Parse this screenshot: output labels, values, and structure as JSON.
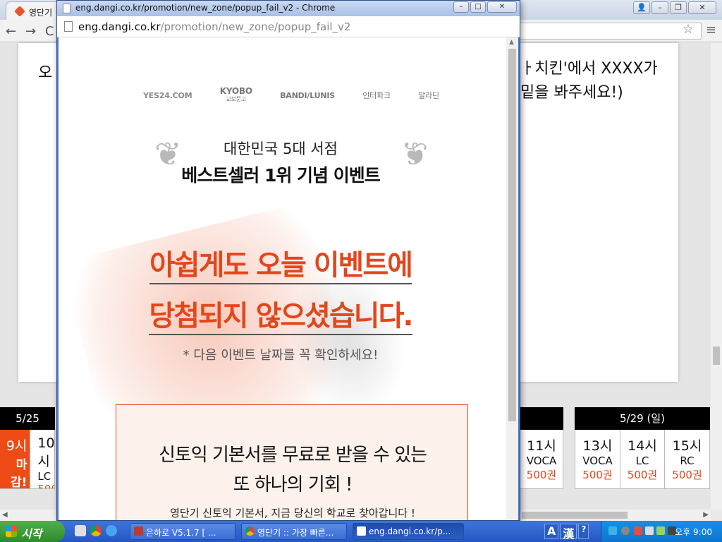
{
  "bg_window": {
    "tab_label": "영단기",
    "card_text_left": "오",
    "card_text_right_1": "ㅏ치킨'에서 XXXX가",
    "card_text_right_2": "밑을 봐주세요!)",
    "schedule_left": {
      "date": "5/25",
      "cells": [
        {
          "time": "9시",
          "label": "마감!",
          "closed": true
        },
        {
          "time": "10시",
          "subject": "LC",
          "price": "500권"
        }
      ]
    },
    "schedule_mid": {
      "cells": [
        {
          "time": "11시",
          "subject": "VOCA",
          "price": "500권"
        }
      ]
    },
    "schedule_right": {
      "date": "5/29 (일)",
      "cells": [
        {
          "time": "13시",
          "subject": "VOCA",
          "price": "500권"
        },
        {
          "time": "14시",
          "subject": "LC",
          "price": "500권"
        },
        {
          "time": "15시",
          "subject": "RC",
          "price": "500권"
        }
      ]
    }
  },
  "popup": {
    "title": "eng.dangi.co.kr/promotion/new_zone/popup_fail_v2 - Chrome",
    "url_domain": "eng.dangi.co.kr",
    "url_path": "/promotion/new_zone/popup_fail_v2",
    "logos": [
      "YES24.COM",
      "KYOBO",
      "교보문고",
      "BANDI/LUNIS",
      "인터파크",
      "알라딘"
    ],
    "subtitle": "대한민국 5대 서점",
    "main_title": "베스트셀러 1위 기념 이벤트",
    "fail_line_1": "아쉽게도 오늘 이벤트에",
    "fail_line_2": "당첨되지 않으셨습니다.",
    "note": "* 다음 이벤트 날짜를 꼭 확인하세요!",
    "promo_line_1": "신토익 기본서를 무료로 받을 수 있는",
    "promo_line_2": "또 하나의 기회 !",
    "promo_desc": "영단기 신토익 기본서, 지금 당신의 학교로 찾아갑니다 !"
  },
  "taskbar": {
    "start_label": "시작",
    "tasks": [
      "은하로 V5.1.7 [ ...",
      "영단기 :: 가장 빠른...",
      "eng.dangi.co.kr/p..."
    ],
    "ime_1": "A",
    "ime_2": "漢",
    "clock": "오후 9:00"
  },
  "colors": {
    "accent_orange": "#e2471c",
    "taskbar_blue": "#2457c4",
    "start_green": "#3a9a36"
  }
}
